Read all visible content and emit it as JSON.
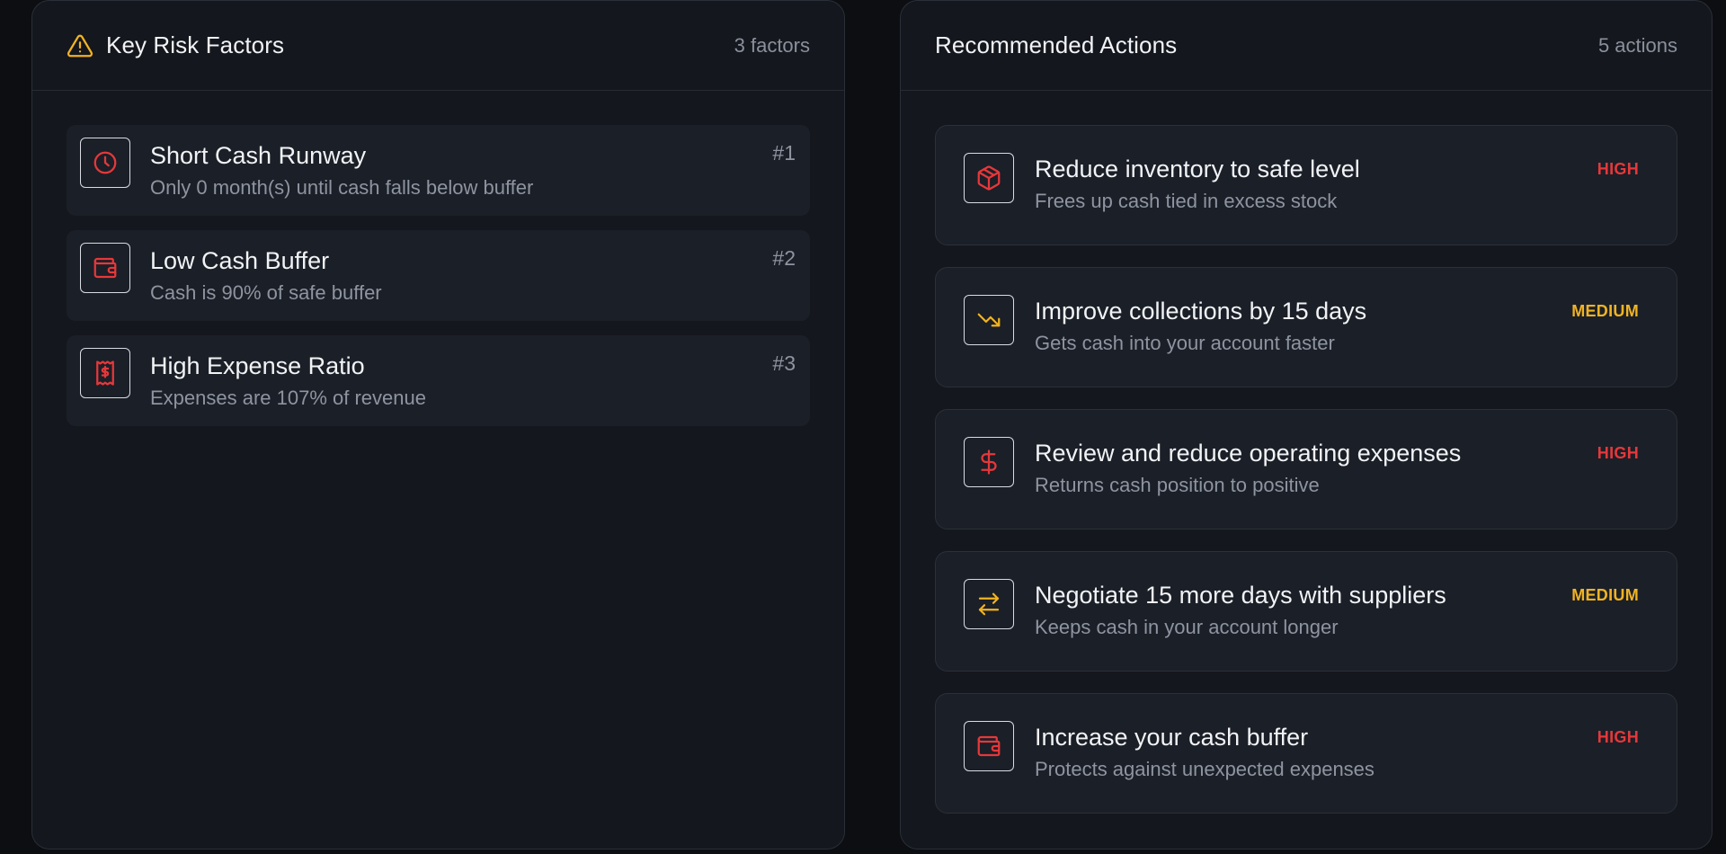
{
  "risk_panel": {
    "title": "Key Risk Factors",
    "count": "3 factors",
    "header_icon": "warning-triangle-icon",
    "items": [
      {
        "icon": "clock-icon",
        "title": "Short Cash Runway",
        "description": "Only 0 month(s) until cash falls below buffer",
        "rank": "#1"
      },
      {
        "icon": "wallet-icon",
        "title": "Low Cash Buffer",
        "description": "Cash is 90% of safe buffer",
        "rank": "#2"
      },
      {
        "icon": "receipt-dollar-icon",
        "title": "High Expense Ratio",
        "description": "Expenses are 107% of revenue",
        "rank": "#3"
      }
    ]
  },
  "actions_panel": {
    "title": "Recommended Actions",
    "count": "5 actions",
    "items": [
      {
        "icon": "package-icon",
        "title": "Reduce inventory to safe level",
        "description": "Frees up cash tied in excess stock",
        "priority": "HIGH"
      },
      {
        "icon": "trending-down-icon",
        "title": "Improve collections by 15 days",
        "description": "Gets cash into your account faster",
        "priority": "MEDIUM"
      },
      {
        "icon": "dollar-icon",
        "title": "Review and reduce operating expenses",
        "description": "Returns cash position to positive",
        "priority": "HIGH"
      },
      {
        "icon": "arrows-exchange-icon",
        "title": "Negotiate 15 more days with suppliers",
        "description": "Keeps cash in your account longer",
        "priority": "MEDIUM"
      },
      {
        "icon": "wallet-icon",
        "title": "Increase your cash buffer",
        "description": "Protects against unexpected expenses",
        "priority": "HIGH"
      }
    ]
  },
  "colors": {
    "high": "#e5383b",
    "medium": "#f0b323",
    "warning": "#f0b323",
    "risk_icon": "#e5383b"
  }
}
